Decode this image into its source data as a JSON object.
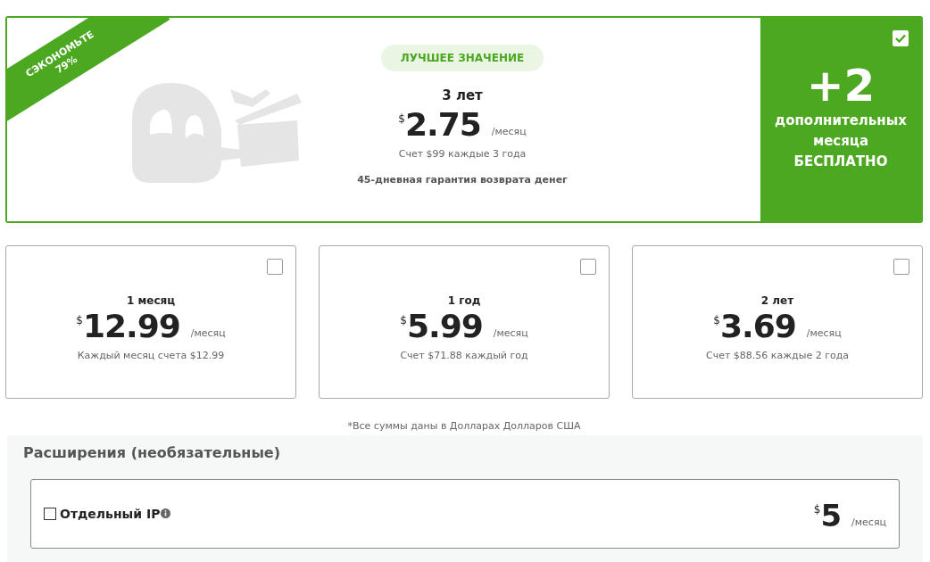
{
  "featured_plan": {
    "ribbon": [
      "СЭКОНОМЬТЕ",
      "79%"
    ],
    "badge": "ЛУЧШЕЕ ЗНАЧЕНИЕ",
    "term": "3 лет",
    "currency": "$",
    "price": "2.75",
    "per": "/месяц",
    "billing": "Счет $99 каждые 3 года",
    "guarantee": "45-дневная гарантия возврата денег",
    "selected": true,
    "bonus": {
      "amount": "+2",
      "lines": [
        "дополнительных",
        "месяца",
        "БЕСПЛАТНО"
      ]
    }
  },
  "plans": [
    {
      "term": "1 месяц",
      "currency": "$",
      "price": "12.99",
      "per": "/месяц",
      "billing": "Каждый месяц счета $12.99",
      "selected": false
    },
    {
      "term": "1 год",
      "currency": "$",
      "price": "5.99",
      "per": "/месяц",
      "billing": "Счет $71.88 каждый год",
      "selected": false
    },
    {
      "term": "2 лет",
      "currency": "$",
      "price": "3.69",
      "per": "/месяц",
      "billing": "Счет $88.56 каждые 2 года",
      "selected": false
    }
  ],
  "footnote": "*Все суммы даны в Долларах Долларов США",
  "extensions": {
    "title": "Расширения (необязательные)",
    "items": [
      {
        "label": "Отдельный IP",
        "checked": false,
        "currency": "$",
        "price": "5",
        "per": "/месяц"
      }
    ]
  }
}
